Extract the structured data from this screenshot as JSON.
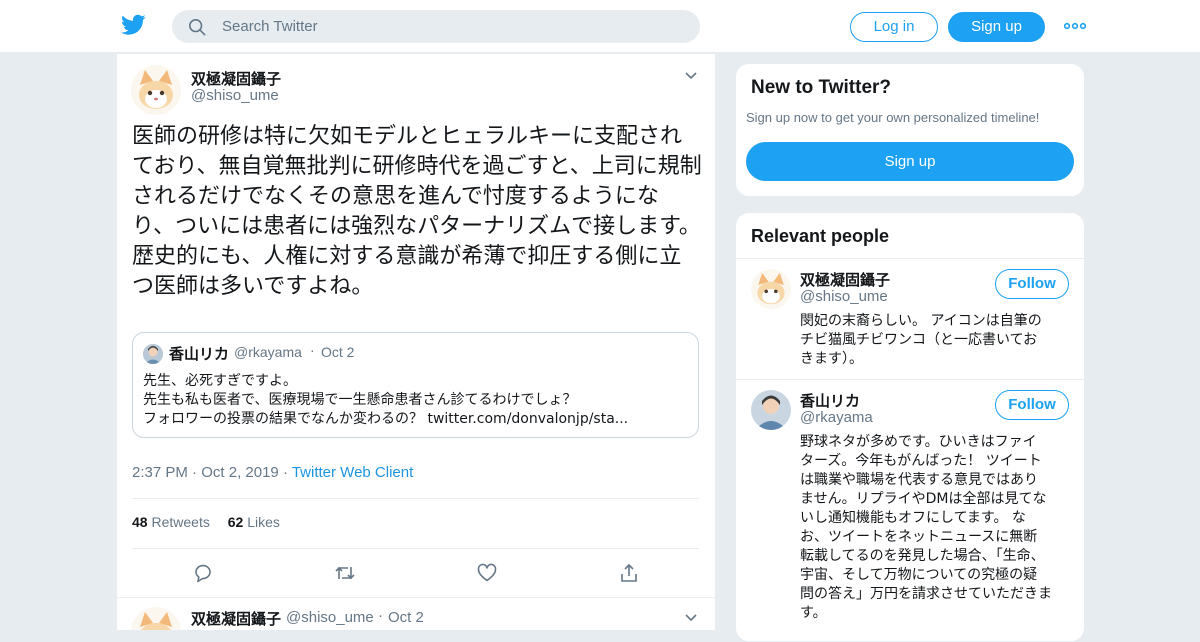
{
  "header": {
    "search_placeholder": "Search Twitter",
    "login_label": "Log in",
    "signup_label": "Sign up",
    "brand_color": "#1da1f2",
    "logo_icon": "twitter-bird-icon",
    "more_icon": "more-dots-icon"
  },
  "tweet": {
    "author_name": "双極凝固鑷子",
    "author_handle": "@shiso_ume",
    "text": "医師の研修は特に欠如モデルとヒェラルキーに支配されており、無自覚無批判に研修時代を過ごすと、上司に規制されるだけでなくその意思を進んで忖度するようになり、ついには患者には強烈なパターナリズムで接します。歴史的にも、人権に対する意識が希薄で抑圧する側に立つ医師は多いですよね。",
    "quoted": {
      "author_name": "香山リカ",
      "author_handle": "@rkayama",
      "date": "Oct 2",
      "lines": [
        "先生、必死すぎですよ。",
        "先生も私も医者で、医療現場で一生懸命患者さん診てるわけでしょ？",
        "フォロワーの投票の結果でなんか変わるの？ twitter.com/donvalonjp/sta..."
      ]
    },
    "time": "2:37 PM",
    "date": "Oct 2, 2019",
    "client": "Twitter Web Client",
    "retweets_count": "48",
    "retweets_label": "Retweets",
    "likes_count": "62",
    "likes_label": "Likes",
    "actions": [
      "reply-icon",
      "retweet-icon",
      "like-icon",
      "share-icon"
    ]
  },
  "next_tweet": {
    "author_name": "双極凝固鑷子",
    "author_handle": "@shiso_ume",
    "date": "Oct 2"
  },
  "signup_card": {
    "title": "New to Twitter?",
    "subtitle": "Sign up now to get your own personalized timeline!",
    "button_label": "Sign up"
  },
  "relevant_people": {
    "title": "Relevant people",
    "follow_label": "Follow",
    "people": [
      {
        "name": "双極凝固鑷子",
        "handle": "@shiso_ume",
        "bio_lines": [
          "閔妃の末裔らしい。 アイコンは自筆の",
          "チビ猫風チビワンコ（と一応書いてお",
          "きます）。"
        ]
      },
      {
        "name": "香山リカ",
        "handle": "@rkayama",
        "bio_lines": [
          "野球ネタが多めです。ひいきはファイ",
          "ターズ。今年もがんばった！ ツイート",
          "は職業や職場を代表する意見ではあり",
          "ません。リプライやDMは全部は見てな",
          "いし通知機能もオフにしてます。 な",
          "お、ツイートをネットニュースに無断",
          "転載してるのを発見した場合、「生命、",
          "宇宙、そして万物についての究極の疑",
          "問の答え」万円を請求させていただきま",
          "す。"
        ]
      }
    ]
  }
}
